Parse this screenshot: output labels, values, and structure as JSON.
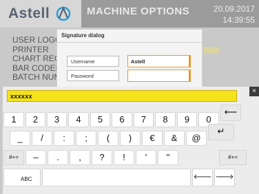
{
  "header": {
    "logo": "Astell",
    "title": "MACHINE OPTIONS",
    "date": "20.09.2017",
    "time": "14:39:55"
  },
  "menu_items": [
    "USER LOGG",
    "PRINTER",
    "CHART REC",
    "BAR CODER",
    "BATCH NUM"
  ],
  "dialog": {
    "title": "Signature dialog",
    "username_label": "Username",
    "username_value": "Astell",
    "password_label": "Password",
    "password_value": ""
  },
  "keyboard": {
    "close": "×",
    "entry_text": "xxxxxx",
    "row1": [
      "1",
      "2",
      "3",
      "4",
      "5",
      "6",
      "7",
      "8",
      "9",
      "0"
    ],
    "backspace": "⟵",
    "row2": [
      "_",
      "/",
      ":",
      ";",
      "(",
      ")",
      "€",
      "&",
      "@"
    ],
    "enter": "↵",
    "row3_left_mode": "#+=",
    "row3": [
      "–",
      ".",
      ",",
      "?",
      "!",
      "'",
      "\""
    ],
    "row3_right_mode": "#+=",
    "abc": "ABC",
    "arrow_left": "🡐",
    "arrow_right": "🡒"
  },
  "colors": {
    "accent_input_border": "#e39b2c",
    "entry_bg": "#f4e21a"
  }
}
